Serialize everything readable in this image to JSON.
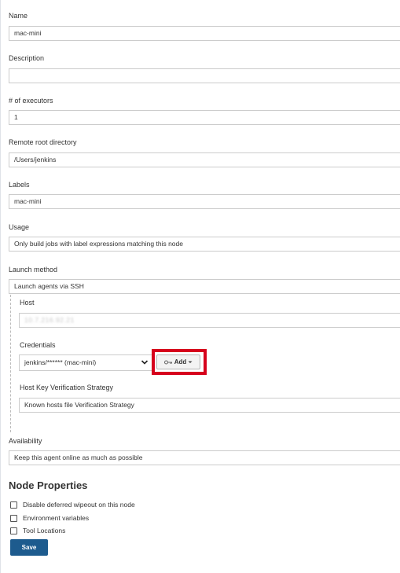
{
  "form": {
    "name": {
      "label": "Name",
      "value": "mac-mini"
    },
    "description": {
      "label": "Description",
      "value": ""
    },
    "executors": {
      "label": "# of executors",
      "value": "1"
    },
    "remote_root": {
      "label": "Remote root directory",
      "value": "/Users/jenkins"
    },
    "labels": {
      "label": "Labels",
      "value": "mac-mini"
    },
    "usage": {
      "label": "Usage",
      "value": "Only build jobs with label expressions matching this node"
    },
    "launch_method": {
      "label": "Launch method",
      "value": "Launch agents via SSH"
    },
    "host": {
      "label": "Host",
      "value": "10.7.216.92.21"
    },
    "credentials": {
      "label": "Credentials",
      "selected": "jenkins/****** (mac-mini)",
      "add_label": "Add"
    },
    "host_key": {
      "label": "Host Key Verification Strategy",
      "value": "Known hosts file Verification Strategy"
    },
    "availability": {
      "label": "Availability",
      "value": "Keep this agent online as much as possible"
    }
  },
  "node_properties": {
    "title": "Node Properties",
    "items": [
      {
        "label": "Disable deferred wipeout on this node",
        "checked": false
      },
      {
        "label": "Environment variables",
        "checked": false
      },
      {
        "label": "Tool Locations",
        "checked": false
      }
    ]
  },
  "save_label": "Save",
  "colors": {
    "highlight": "#d6001c",
    "save_button": "#1d5b8e"
  }
}
